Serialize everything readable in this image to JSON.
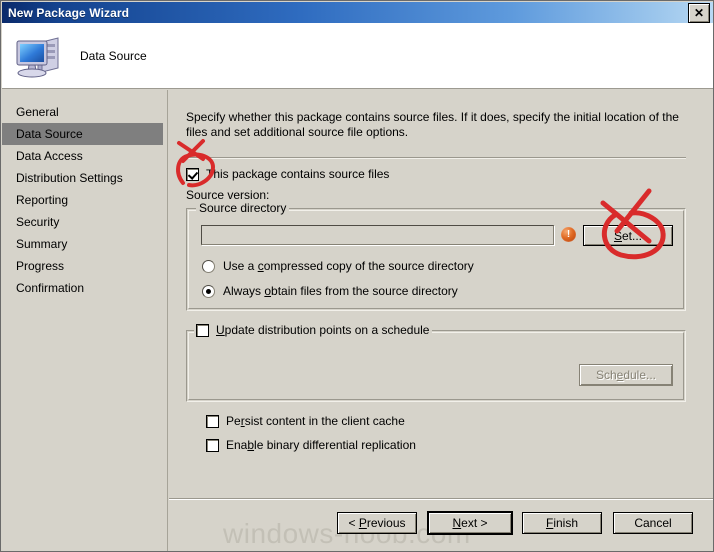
{
  "window": {
    "title": "New Package Wizard",
    "close_label": "✕",
    "close_icon": "close-icon"
  },
  "header": {
    "title": "Data Source",
    "icon": "computer-icon"
  },
  "sidebar": {
    "items": [
      {
        "label": "General",
        "selected": false
      },
      {
        "label": "Data Source",
        "selected": true
      },
      {
        "label": "Data Access",
        "selected": false
      },
      {
        "label": "Distribution Settings",
        "selected": false
      },
      {
        "label": "Reporting",
        "selected": false
      },
      {
        "label": "Security",
        "selected": false
      },
      {
        "label": "Summary",
        "selected": false
      },
      {
        "label": "Progress",
        "selected": false
      },
      {
        "label": "Confirmation",
        "selected": false
      }
    ]
  },
  "main": {
    "intro": "Specify whether this package contains source files. If it does, specify the initial location of the files and set additional source file options.",
    "contains_source_files": {
      "label": "This package contains source files",
      "checked": true
    },
    "source_version_label": "Source version:",
    "source_directory_group": {
      "label": "Source directory",
      "path_value": "",
      "path_placeholder": "",
      "error_icon": "error-icon",
      "error_glyph": "!",
      "set_button": "Set...",
      "radios": [
        {
          "label": "Use a compressed copy of the source directory",
          "selected": false
        },
        {
          "label": "Always obtain files from the source directory",
          "selected": true
        }
      ]
    },
    "update_dp_group": {
      "label": "Update distribution points on a schedule",
      "checked": false,
      "schedule_button": "Schedule...",
      "schedule_disabled": true
    },
    "persist_content": {
      "label": "Persist content in the client cache",
      "checked": false
    },
    "binary_diff": {
      "label": "Enable binary differential replication",
      "checked": false
    }
  },
  "footer": {
    "buttons": [
      {
        "label": "< Previous",
        "default": false,
        "disabled": false
      },
      {
        "label": "Next >",
        "default": true,
        "disabled": false
      },
      {
        "label": "Finish",
        "default": false,
        "disabled": false
      },
      {
        "label": "Cancel",
        "default": false,
        "disabled": false
      }
    ]
  },
  "watermark": {
    "text": "windows-noob.com"
  },
  "annotations": {
    "color": "#d92b2b",
    "marks": [
      {
        "name": "checkbox-circle-annotation",
        "shape": "circle-with-cross"
      },
      {
        "name": "set-button-circle-annotation",
        "shape": "circle-with-cross"
      }
    ]
  }
}
